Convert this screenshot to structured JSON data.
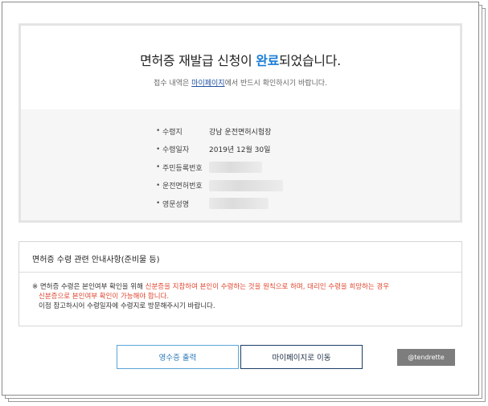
{
  "header": {
    "title_prefix": "면허증 재발급 신청이 ",
    "title_highlight": "완료",
    "title_suffix": "되었습니다.",
    "sub_prefix": "접수 내역은 ",
    "sub_link": "마이페이지",
    "sub_suffix": "에서 반드시 확인하시기 바랍니다."
  },
  "info": {
    "bullet": "•",
    "rows": [
      {
        "label": "수령지",
        "value": "강남 운전면허시험장",
        "masked": false
      },
      {
        "label": "수령일자",
        "value": "2019년 12월 30일",
        "masked": false
      },
      {
        "label": "주민등록번호",
        "value": "",
        "masked": true
      },
      {
        "label": "운전면허번호",
        "value": "",
        "masked": true
      },
      {
        "label": "영문성명",
        "value": "",
        "masked": true
      }
    ]
  },
  "notice": {
    "title": "면허증 수령 관련 안내사항(준비물 등)",
    "line1_black": "※ 면허증 수령은 본인여부 확인을 위해 ",
    "line1_red": "신분증을 지참하여 본인이 수령하는 것을 원칙으로 하며, 대리인 수령을 희망하는 경우",
    "line2_red": "신분증으로 본인여부 확인이 가능해야 합니다.",
    "line3_black": "이점 참고하시어 수령일자에 수령지로 방문해주시기 바랍니다."
  },
  "buttons": {
    "receipt": "영수증 출력",
    "mypage": "마이페이지로 이동"
  },
  "watermark": "@tendrette",
  "colors": {
    "highlight": "#1a7dd6",
    "notice_red": "#e0462f",
    "receipt_border": "#5aa5d8",
    "mypage_border": "#1c3d66"
  }
}
